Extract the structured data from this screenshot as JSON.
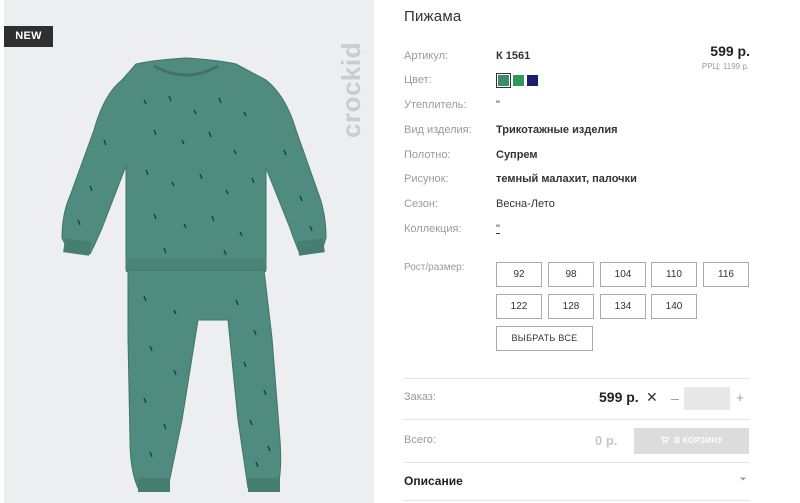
{
  "badge": "NEW",
  "brand": "crockid",
  "title": "Пижама",
  "props": {
    "article": {
      "label": "Артикул:",
      "value": "К 1561"
    },
    "color": {
      "label": "Цвет:"
    },
    "insulation": {
      "label": "Утеплитель:",
      "value": "\""
    },
    "type": {
      "label": "Вид изделия:",
      "value": "Трикотажные изделия"
    },
    "fabric": {
      "label": "Полотно:",
      "value": "Супрем"
    },
    "pattern": {
      "label": "Рисунок:",
      "value": "темный малахит, палочки"
    },
    "season": {
      "label": "Сезон:",
      "value": "Весна-Лето"
    },
    "collection": {
      "label": "Коллекция:",
      "value": "\""
    }
  },
  "price": "599 р.",
  "rrp": "РРЦ: 1199 р.",
  "swatches": [
    {
      "name": "dark-malachite",
      "color": "#3f8a68",
      "active": true
    },
    {
      "name": "green",
      "color": "#2e9a5a",
      "active": false
    },
    {
      "name": "navy",
      "color": "#1c1f6b",
      "active": false
    }
  ],
  "sizes": {
    "label": "Рост/размер:",
    "options": [
      "92",
      "98",
      "104",
      "110",
      "116",
      "122",
      "128",
      "134",
      "140"
    ],
    "select_all": "ВЫБРАТЬ ВСЕ"
  },
  "order": {
    "label": "Заказ:",
    "price": "599 р.",
    "times": "✕",
    "minus": "–",
    "plus": "+"
  },
  "total": {
    "label": "Всего:",
    "value": "0 р.",
    "cart_button": "В КОРЗИНУ"
  },
  "description": {
    "label": "Описание"
  },
  "colors": {
    "garment": "#4e8a7e",
    "garment_shadow": "#3e7468",
    "photo_bg": "#eceeef"
  }
}
